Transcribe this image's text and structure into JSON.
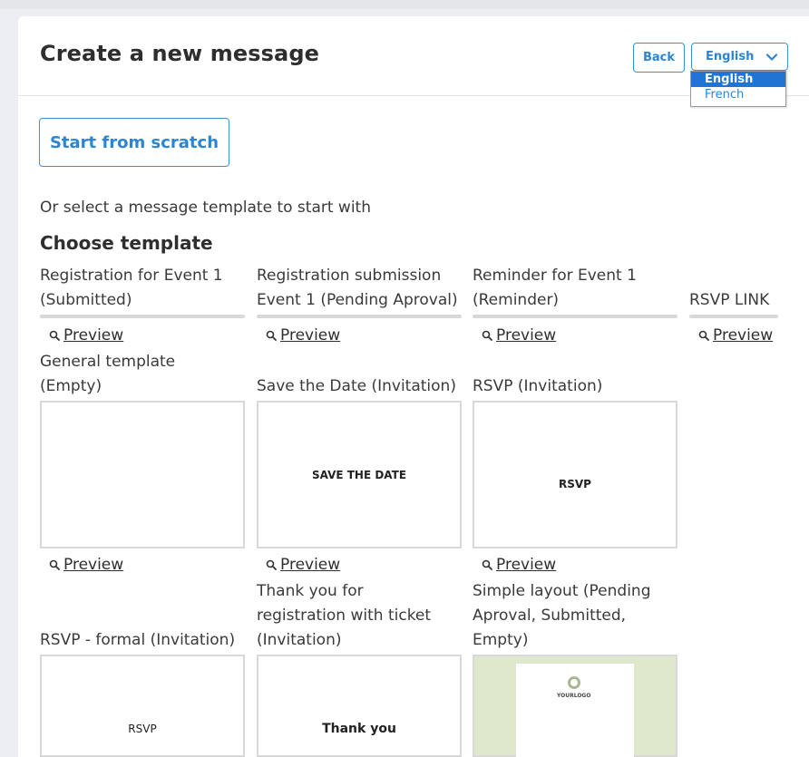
{
  "header": {
    "title": "Create a new message",
    "back_label": "Back",
    "language": {
      "selected": "English",
      "options": [
        "English",
        "French"
      ]
    }
  },
  "start_label": "Start from scratch",
  "or_text": "Or select a message template to start with",
  "choose_label": "Choose template",
  "preview_label": "Preview",
  "templates": [
    {
      "name_lines": [
        "Registration for Event 1",
        "(Submitted)"
      ]
    },
    {
      "name_lines": [
        "Registration submission",
        "Event 1 (Pending Aproval)"
      ]
    },
    {
      "name_lines": [
        "Reminder for Event 1",
        "(Reminder)"
      ]
    },
    {
      "name_lines": [
        "RSVP LINK"
      ]
    },
    {
      "name_lines": [
        "General template",
        "(Empty)"
      ]
    },
    {
      "name_lines": [
        "Save the Date (Invitation)"
      ],
      "thumb_text": "SAVE THE DATE"
    },
    {
      "name_lines": [
        "RSVP (Invitation)"
      ],
      "thumb_text": "RSVP"
    },
    {
      "name_lines": [
        "RSVP - formal (Invitation)"
      ],
      "thumb_text": "RSVP"
    },
    {
      "name_lines": [
        "Thank you for",
        "registration with ticket",
        "(Invitation)"
      ],
      "thumb_text": "Thank you"
    },
    {
      "name_lines": [
        "Simple layout (Pending",
        "Aproval, Submitted,",
        "Empty)"
      ],
      "thumb_text": "YOURLOGO"
    }
  ],
  "colors": {
    "accent": "#2d85d1",
    "selected_option": "#1f74d4",
    "thumb_border": "#d9d9d9",
    "green_thumb": "#dfe8cc"
  }
}
